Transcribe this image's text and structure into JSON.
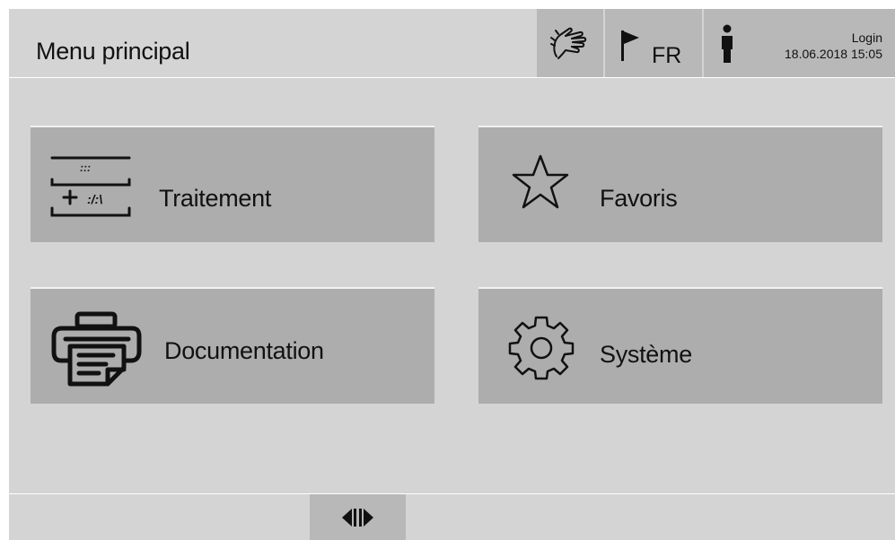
{
  "header": {
    "title": "Menu principal",
    "language": "FR",
    "login_label": "Login",
    "datetime": "18.06.2018  15:05"
  },
  "tiles": [
    {
      "label": "Traitement",
      "icon": "treatment-icon"
    },
    {
      "label": "Favoris",
      "icon": "star-icon"
    },
    {
      "label": "Documentation",
      "icon": "printer-icon"
    },
    {
      "label": "Système",
      "icon": "gear-icon"
    }
  ],
  "footer": {
    "toggle_icon": "panel-toggle-icon"
  },
  "colors": {
    "background": "#d4d4d4",
    "tile": "#adadad",
    "header_button": "#b8b8b8"
  }
}
